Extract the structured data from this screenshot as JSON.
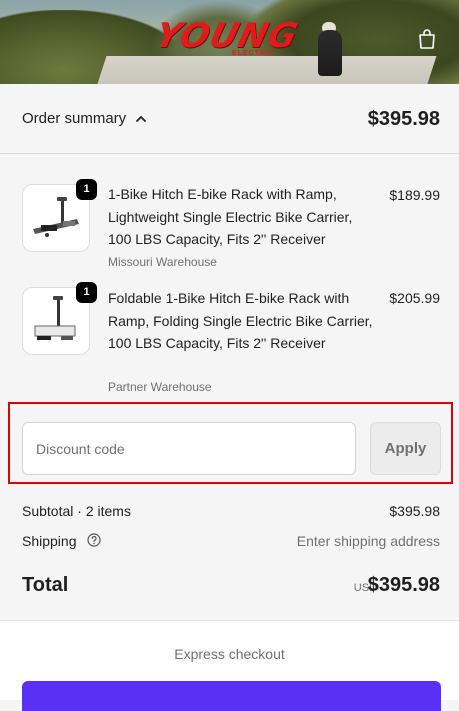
{
  "header": {
    "brand_logo": "YOUNG",
    "brand_sub": "ELECTRIC",
    "cart_icon": "shopping-bag-icon"
  },
  "summary_toggle": {
    "label": "Order summary",
    "chevron_icon": "chevron-up-icon",
    "total": "$395.98"
  },
  "products": [
    {
      "quantity": "1",
      "title": "1-Bike Hitch E-bike Rack with Ramp, Lightweight Single Electric Bike Carrier, 100 LBS Capacity, Fits 2'' Receiver",
      "warehouse": "Missouri Warehouse",
      "price": "$189.99"
    },
    {
      "quantity": "1",
      "title": "Foldable 1-Bike Hitch E-bike Rack with Ramp, Folding Single Electric Bike Carrier, 100 LBS Capacity, Fits 2'' Receiver",
      "warehouse": "Partner Warehouse",
      "price": "$205.99"
    }
  ],
  "discount": {
    "placeholder": "Discount code",
    "value": "",
    "apply_label": "Apply"
  },
  "totals": {
    "subtotal_label": "Subtotal · 2 items",
    "subtotal_value": "$395.98",
    "shipping_label": "Shipping",
    "shipping_value": "Enter shipping address",
    "total_label": "Total",
    "currency": "USD",
    "total_value": "$395.98"
  },
  "express": {
    "title": "Express checkout"
  },
  "colors": {
    "highlight_border": "#e00000",
    "brand_red": "#e01b1b",
    "express_button": "#5a31f4"
  }
}
